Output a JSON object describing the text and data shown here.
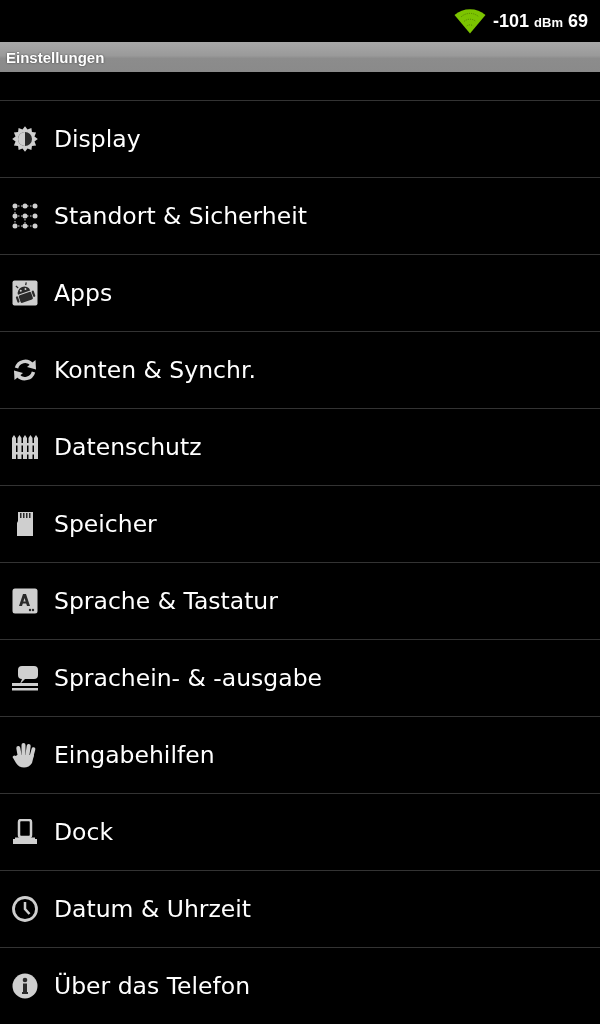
{
  "status_bar": {
    "signal_value": "-101",
    "signal_unit": "dBm",
    "value_2": "69"
  },
  "title_bar": {
    "title": "Einstellungen"
  },
  "settings": [
    {
      "label": "Display"
    },
    {
      "label": "Standort & Sicherheit"
    },
    {
      "label": "Apps"
    },
    {
      "label": "Konten & Synchr."
    },
    {
      "label": "Datenschutz"
    },
    {
      "label": "Speicher"
    },
    {
      "label": "Sprache & Tastatur"
    },
    {
      "label": "Sprachein- & -ausgabe"
    },
    {
      "label": "Eingabehilfen"
    },
    {
      "label": "Dock"
    },
    {
      "label": "Datum & Uhrzeit"
    },
    {
      "label": "Über das Telefon"
    }
  ]
}
